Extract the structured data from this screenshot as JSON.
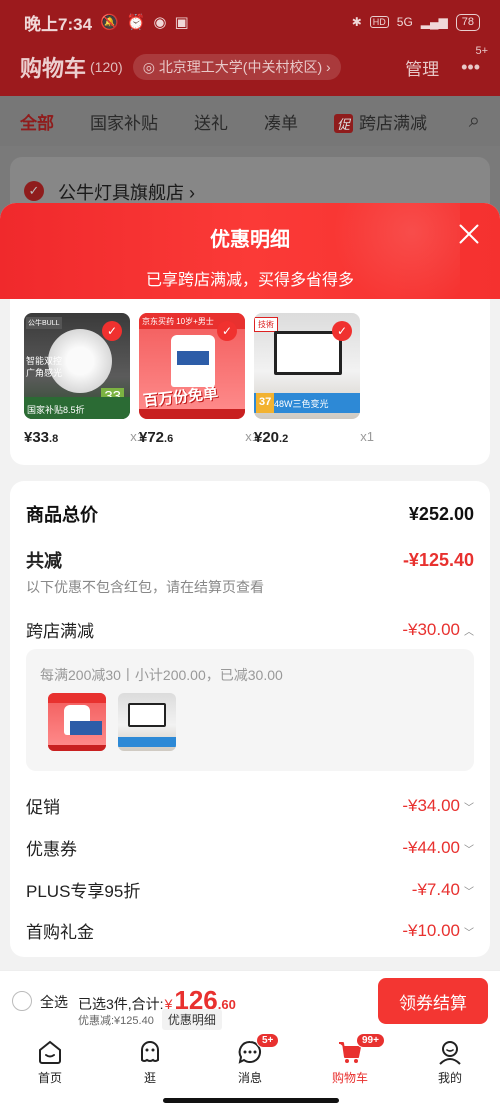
{
  "status": {
    "time": "晚上7:34",
    "network": "5G",
    "battery": "78"
  },
  "header": {
    "title": "购物车",
    "count": "(120)",
    "location": "北京理工大学(中关村校区)",
    "manage": "管理",
    "more_badge": "5+"
  },
  "tabs": [
    "全部",
    "国家补贴",
    "送礼",
    "凑单",
    "跨店满减"
  ],
  "tab_promo": "促",
  "store": {
    "name": "公牛灯具旗舰店"
  },
  "sheet": {
    "title": "优惠明细",
    "subtitle": "已享跨店满减，买得多省得多"
  },
  "products": [
    {
      "price_int": "¥33",
      "price_dec": ".8",
      "qty": "x1",
      "img_text": "智能双控\n广角感光",
      "img_strip": "国家补贴8.5折",
      "img_num": "33",
      "img_brand": "公牛BULL"
    },
    {
      "price_int": "¥72",
      "price_dec": ".6",
      "qty": "x1",
      "img_bar": "京东买药 10岁+男士",
      "img_big": "百万份免单"
    },
    {
      "price_int": "¥20",
      "price_dec": ".2",
      "qty": "x1",
      "img_tag": "技術",
      "img_num": "37",
      "img_w": "48W三色变光"
    }
  ],
  "summary": {
    "total_label": "商品总价",
    "total_value": "¥252.00",
    "reduce_label": "共减",
    "reduce_value": "-¥125.40",
    "note": "以下优惠不包含红包，请在结算页查看",
    "cross_label": "跨店满减",
    "cross_value": "-¥30.00",
    "cross_desc": "每满200减30丨小计200.00，已减30.00",
    "promo_label": "促销",
    "promo_value": "-¥34.00",
    "coupon_label": "优惠券",
    "coupon_value": "-¥44.00",
    "plus_label": "PLUS专享95折",
    "plus_value": "-¥7.40",
    "gift_label": "首购礼金",
    "gift_value": "-¥10.00"
  },
  "checkout": {
    "select_all": "全选",
    "selected": "已选3件,合计:",
    "yen": "¥",
    "price_int": "126",
    "price_dec": ".60",
    "discount": "优惠减:¥125.40",
    "detail": "优惠明细",
    "button": "领券结算"
  },
  "nav": [
    {
      "label": "首页",
      "icon": "home-icon"
    },
    {
      "label": "逛",
      "icon": "browse-icon"
    },
    {
      "label": "消息",
      "icon": "message-icon",
      "badge": "5+"
    },
    {
      "label": "购物车",
      "icon": "cart-icon",
      "badge": "99+"
    },
    {
      "label": "我的",
      "icon": "profile-icon"
    }
  ],
  "colors": {
    "accent": "#e8312f",
    "sheet_header": "#f5312f"
  }
}
